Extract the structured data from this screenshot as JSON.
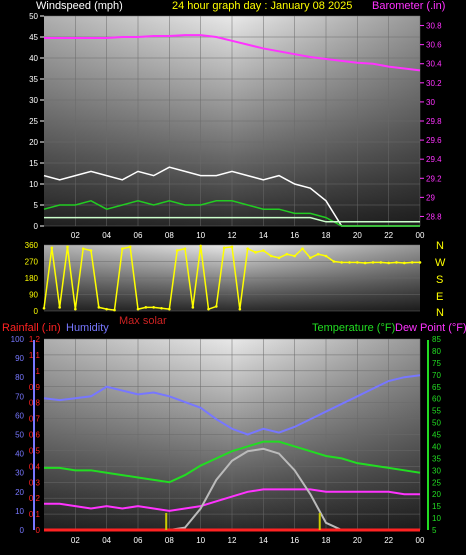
{
  "header": {
    "left_title": "Windspeed (mph)",
    "center_title": "24 hour graph day : January 08 2025",
    "right_title": "Barometer (.in)"
  },
  "colors": {
    "background": "#000000",
    "barometer": "#ff33ff",
    "wind_gust": "#ffffff",
    "wind_speed": "#22cc22",
    "wind_avg": "#ccffcc",
    "direction": "#ffff00",
    "rainfall": "#ff2222",
    "humidity": "#7777ff",
    "max_solar": "#cc2222",
    "temperature": "#22dd22",
    "dew_point": "#ff33ff",
    "solar_curve": "#bbbbbb",
    "uv_marker": "#cccc00"
  },
  "compass_labels": [
    "N",
    "W",
    "S",
    "E",
    "N"
  ],
  "bottom_labels": {
    "rainfall": "Rainfall (.in)",
    "humidity": "Humidity",
    "max_solar": "Max solar",
    "temperature": "Temperature (°F)",
    "dew_point": "Dew Point (°F)"
  },
  "chart_data": [
    {
      "type": "line",
      "name": "wind_barometer",
      "x_ticks": [
        "02",
        "04",
        "06",
        "08",
        "10",
        "12",
        "14",
        "16",
        "18",
        "20",
        "22",
        "00"
      ],
      "ylabel": "Windspeed (mph)",
      "y_ticks": [
        0,
        5,
        10,
        15,
        20,
        25,
        30,
        35,
        40,
        45,
        50
      ],
      "ylim": [
        0,
        50
      ],
      "y2label": "Barometer (.in)",
      "y2_ticks": [
        "28.8",
        "29",
        "29.2",
        "29.4",
        "29.6",
        "29.8",
        "30",
        "30.2",
        "30.4",
        "30.6",
        "30.8"
      ],
      "y2lim": [
        28.7,
        30.9
      ],
      "x": [
        0,
        1,
        2,
        3,
        4,
        5,
        6,
        7,
        8,
        9,
        10,
        11,
        12,
        13,
        14,
        15,
        16,
        17,
        18,
        19,
        20,
        21,
        22,
        23,
        24
      ],
      "series": [
        {
          "name": "Barometer",
          "axis": "y2",
          "values": [
            30.67,
            30.67,
            30.67,
            30.67,
            30.67,
            30.68,
            30.68,
            30.69,
            30.69,
            30.7,
            30.7,
            30.68,
            30.64,
            30.6,
            30.56,
            30.53,
            30.5,
            30.47,
            30.45,
            30.43,
            30.41,
            30.4,
            30.37,
            30.35,
            30.33
          ]
        },
        {
          "name": "Gust",
          "axis": "y",
          "values": [
            12,
            11,
            12,
            13,
            12,
            11,
            13,
            12,
            14,
            13,
            12,
            12,
            13,
            12,
            11,
            12,
            10,
            9,
            6,
            0,
            0,
            0,
            0,
            0,
            0
          ]
        },
        {
          "name": "Speed",
          "axis": "y",
          "values": [
            4,
            5,
            5,
            6,
            4,
            5,
            6,
            5,
            6,
            5,
            5,
            6,
            6,
            5,
            4,
            4,
            3,
            3,
            2,
            0,
            0,
            0,
            0,
            0,
            0
          ]
        },
        {
          "name": "Average",
          "axis": "y",
          "values": [
            2,
            2,
            2,
            2,
            2,
            2,
            2,
            2,
            2,
            2,
            2,
            2,
            2,
            2,
            2,
            2,
            2,
            2,
            1,
            1,
            1,
            1,
            1,
            1,
            1
          ]
        }
      ]
    },
    {
      "type": "scatter",
      "name": "wind_direction",
      "x_ticks": [
        "02",
        "04",
        "06",
        "08",
        "10",
        "12",
        "14",
        "16",
        "18",
        "20",
        "22",
        "00"
      ],
      "y_ticks": [
        0,
        90,
        180,
        270,
        360
      ],
      "ylim": [
        0,
        360
      ],
      "x": [
        0,
        0.5,
        1,
        1.5,
        2,
        2.5,
        3,
        3.5,
        4,
        4.5,
        5,
        5.5,
        6,
        6.5,
        7,
        7.5,
        8,
        8.5,
        9,
        9.5,
        10,
        10.5,
        11,
        11.5,
        12,
        12.5,
        13,
        13.5,
        14,
        14.5,
        15,
        15.5,
        16,
        16.5,
        17,
        17.5,
        18,
        18.5,
        19,
        19.5,
        20,
        20.5,
        21,
        21.5,
        22,
        22.5,
        23,
        23.5,
        24
      ],
      "values": [
        15,
        345,
        20,
        350,
        10,
        340,
        330,
        20,
        10,
        5,
        340,
        350,
        10,
        20,
        20,
        15,
        10,
        330,
        340,
        20,
        355,
        10,
        25,
        345,
        350,
        10,
        340,
        320,
        330,
        300,
        290,
        310,
        300,
        340,
        290,
        310,
        300,
        270,
        265,
        265,
        265,
        262,
        265,
        265,
        262,
        265,
        262,
        265,
        265
      ]
    },
    {
      "type": "line",
      "name": "temperature_humidity",
      "x_ticks": [
        "02",
        "04",
        "06",
        "08",
        "10",
        "12",
        "14",
        "16",
        "18",
        "20",
        "22",
        "00"
      ],
      "ylabel": "Rainfall (.in)",
      "y_ticks": [
        "0",
        "0.1",
        "0.2",
        "0.3",
        "0.4",
        "0.5",
        "0.6",
        "0.7",
        "0.8",
        "0.9",
        "1",
        "1.1",
        "1.2"
      ],
      "ylim": [
        0,
        1.2
      ],
      "y_hum_ticks": [
        0,
        10,
        20,
        30,
        40,
        50,
        60,
        70,
        80,
        90,
        100
      ],
      "y2label": "Temperature (°F)",
      "y2_ticks": [
        5,
        10,
        15,
        20,
        25,
        30,
        35,
        40,
        45,
        50,
        55,
        60,
        65,
        70,
        75,
        80,
        85
      ],
      "y2lim": [
        5,
        85
      ],
      "x": [
        0,
        1,
        2,
        3,
        4,
        5,
        6,
        7,
        8,
        9,
        10,
        11,
        12,
        13,
        14,
        15,
        16,
        17,
        18,
        19,
        20,
        21,
        22,
        23,
        24
      ],
      "series": [
        {
          "name": "Humidity",
          "axis": "humidity",
          "values": [
            69,
            68,
            69,
            70,
            75,
            73,
            71,
            72,
            70,
            67,
            64,
            58,
            53,
            50,
            53,
            51,
            54,
            58,
            62,
            66,
            70,
            74,
            78,
            80,
            81
          ]
        },
        {
          "name": "Temperature",
          "axis": "y2",
          "values": [
            31,
            31,
            30,
            30,
            29,
            28,
            27,
            26,
            25,
            28,
            32,
            35,
            38,
            40,
            42,
            42,
            40,
            38,
            36,
            35,
            33,
            32,
            31,
            30,
            29
          ]
        },
        {
          "name": "Dew Point",
          "axis": "y2",
          "values": [
            16,
            16,
            15,
            14,
            15,
            14,
            15,
            14,
            13,
            14,
            15,
            17,
            19,
            21,
            22,
            22,
            22,
            22,
            21,
            21,
            21,
            21,
            21,
            20,
            20
          ]
        },
        {
          "name": "Max solar",
          "axis": "y2",
          "values": [
            5,
            5,
            5,
            5,
            5,
            5,
            5,
            5,
            5,
            6,
            14,
            26,
            34,
            38,
            39,
            37,
            30,
            20,
            8,
            5,
            5,
            5,
            5,
            5,
            5
          ]
        },
        {
          "name": "Rainfall",
          "axis": "y",
          "values": [
            0,
            0,
            0,
            0,
            0,
            0,
            0,
            0,
            0,
            0,
            0,
            0,
            0,
            0,
            0,
            0,
            0,
            0,
            0,
            0,
            0,
            0,
            0,
            0,
            0
          ]
        }
      ],
      "uv_markers_x": [
        7.8,
        17.6
      ]
    }
  ]
}
